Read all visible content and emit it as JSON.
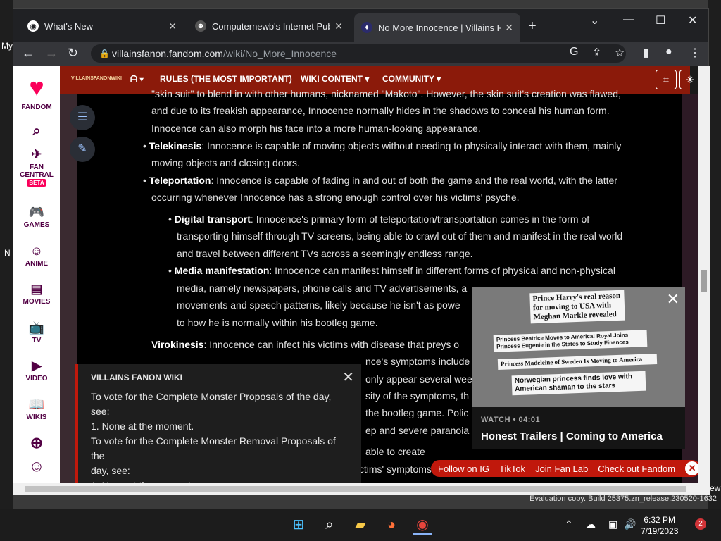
{
  "desktop": {
    "left_labels": [
      "My",
      "N"
    ],
    "right_label": "ew"
  },
  "browser": {
    "tabs": [
      {
        "title": "What's New",
        "active": false
      },
      {
        "title": "Computernewb's Internet Pub H",
        "active": false
      },
      {
        "title": "No More Innocence | Villains Far",
        "active": true
      }
    ],
    "url_host": "villainsfanon.fandom.com",
    "url_path": "/wiki/No_More_Innocence"
  },
  "fandom_rail": {
    "brand": "FANDOM",
    "items": [
      "FAN CENTRAL",
      "GAMES",
      "ANIME",
      "MOVIES",
      "TV",
      "VIDEO",
      "WIKIS"
    ],
    "beta_badge": "BETA"
  },
  "wikibar": {
    "logo_text": "VILLAINSFANONWIKI",
    "menus": [
      "RULES (THE MOST IMPORTANT)",
      "WIKI CONTENT",
      "COMMUNITY"
    ]
  },
  "article": {
    "p1_line1": "\"skin suit\" to blend in with other humans, nicknamed \"Makoto\". However, the skin suit's creation was flawed,",
    "p1_line2": "and due to its freakish appearance, Innocence normally hides in the shadows to conceal his human form.",
    "p1_line3": "Innocence can also morph his face into a more human-looking appearance.",
    "tele_term": "Telekinesis",
    "tele_line1": ": Innocence is capable of moving objects without needing to physically interact with them, mainly",
    "tele_line2": "moving objects and closing doors.",
    "teleport_term": "Teleportation",
    "teleport_line1": ": Innocence is capable of fading in and out of both the game and the real world, with the latter",
    "teleport_line2": "occurring whenever Innocence has a strong enough control over his victims' psyche.",
    "dt_term": "Digital transport",
    "dt_line1": ": Innocence's primary form of teleportation/transportation comes in the form of",
    "dt_line2": "transporting himself through TV screens, being able to crawl out of them and manifest in the real world",
    "dt_line3": "and travel between different TVs across a seemingly endless range.",
    "mm_term": "Media manifestation",
    "mm_line1": ": Innocence can manifest himself in different forms of physical and non-physical",
    "mm_line2": "media, namely newspapers, phone calls and TV advertisements, a",
    "mm_line3": "movements and speech patterns, likely because he isn't as powe",
    "mm_line4": "to how he is normally within his bootleg game.",
    "vir_term": "Virokinesis",
    "vir_line1": ": Innocence can infect his victims with disease that preys o",
    "vir_line2": "nce's symptoms include",
    "vir_line3": "only appear several wee",
    "vir_line4": "sity of the symptoms, th",
    "vir_line5": "the bootleg game. Polic",
    "vir_line6": "ep and severe paranoia",
    "dis_line": "able to create",
    "last_line": "enhance their effectiveness, making his victims' symptoms more severe and leading to their mental"
  },
  "notice": {
    "title": "VILLAINS FANON WIKI",
    "lines": [
      "To vote for the Complete Monster Proposals of the day, see:",
      "1. None at the moment.",
      "To vote for the Complete Monster Removal Proposals of the",
      "day, see:",
      "1. None at the moment."
    ]
  },
  "video": {
    "headlines": [
      "Prince Harry's real reason for moving to USA with Meghan Markle revealed",
      "Princess Beatrice Moves to America! Royal Joins Princess Eugenie in the States to Study Finances",
      "Princess Madeleine of Sweden Is Moving to America",
      "Norwegian princess finds love with American shaman to the stars"
    ],
    "watch_label": "WATCH • 04:01",
    "title": "Honest Trailers | Coming to America"
  },
  "social": [
    "Follow on IG",
    "TikTok",
    "Join Fan Lab",
    "Check out Fandom"
  ],
  "evaluation": "Evaluation copy. Build 25375.zn_release.230520-1632",
  "taskbar": {
    "time": "6:32 PM",
    "date": "7/19/2023",
    "badge": "2"
  },
  "colors": {
    "wikibar": "#8b1a0a",
    "accent_red": "#c0180c",
    "fandom_pink": "#fa005a"
  }
}
